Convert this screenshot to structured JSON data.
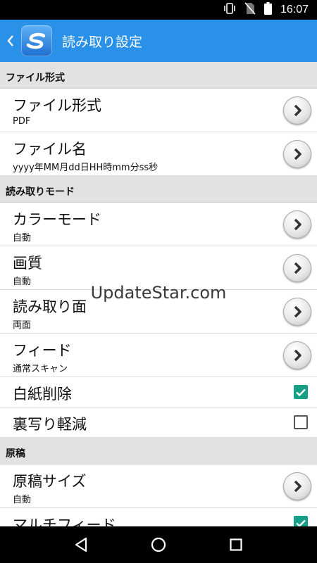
{
  "status_bar": {
    "time": "16:07"
  },
  "app_bar": {
    "title": "読み取り設定"
  },
  "sections": [
    {
      "header": "ファイル形式",
      "rows": [
        {
          "title": "ファイル形式",
          "subtitle": "PDF",
          "control": "chevron"
        },
        {
          "title": "ファイル名",
          "subtitle": "yyyy年MM月dd日HH時mm分ss秒",
          "control": "chevron"
        }
      ]
    },
    {
      "header": "読み取りモード",
      "rows": [
        {
          "title": "カラーモード",
          "subtitle": "自動",
          "control": "chevron"
        },
        {
          "title": "画質",
          "subtitle": "自動",
          "control": "chevron"
        },
        {
          "title": "読み取り面",
          "subtitle": "両面",
          "control": "chevron"
        },
        {
          "title": "フィード",
          "subtitle": "通常スキャン",
          "control": "chevron"
        },
        {
          "title": "白紙削除",
          "control": "checkbox",
          "checked": true
        },
        {
          "title": "裏写り軽減",
          "control": "checkbox",
          "checked": false
        }
      ]
    },
    {
      "header": "原稿",
      "rows": [
        {
          "title": "原稿サイズ",
          "subtitle": "自動",
          "control": "chevron"
        },
        {
          "title": "マルチフィード",
          "control": "checkbox",
          "checked": true
        }
      ]
    }
  ],
  "watermark": "UpdateStar.com",
  "colors": {
    "app_bar": "#2a91e8",
    "checkbox_checked": "#14a087",
    "section_header": "#e2e2e2"
  }
}
